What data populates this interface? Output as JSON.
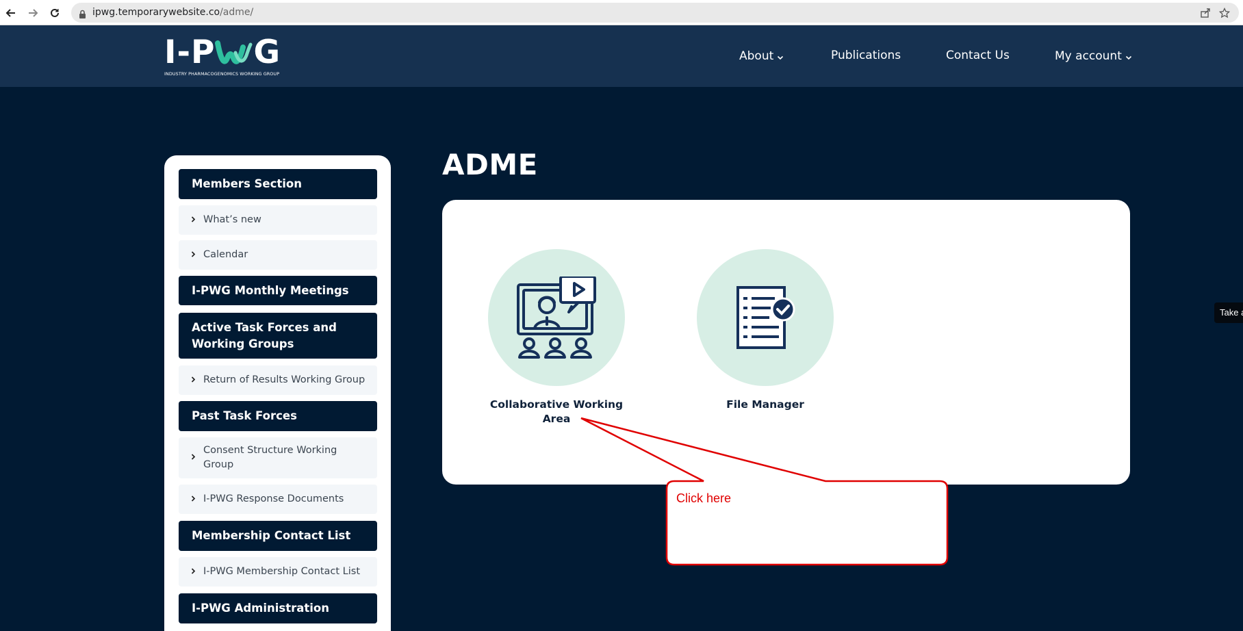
{
  "browser": {
    "url_host": "ipwg.temporarywebsite.co",
    "url_path": "/adme/"
  },
  "header": {
    "logo_text_left": "I-P",
    "logo_text_right": "G",
    "logo_subtitle": "INDUSTRY PHARMACOGENOMICS WORKING GROUP",
    "nav": {
      "about": "About",
      "publications": "Publications",
      "contact": "Contact Us",
      "account": "My account"
    }
  },
  "sidebar": {
    "members_section": "Members Section",
    "whats_new": "What’s new",
    "calendar": "Calendar",
    "monthly_meetings": "I-PWG Monthly Meetings",
    "active_task_forces": "Active Task Forces and Working Groups",
    "return_results": "Return of Results Working Group",
    "past_task_forces": "Past Task Forces",
    "consent_structure": "Consent Structure Working Group",
    "response_documents": "I-PWG Response Documents",
    "membership_contact": "Membership Contact List",
    "membership_contact_item": "I-PWG Membership Contact List",
    "administration": "I-PWG Administration"
  },
  "main": {
    "title": "ADME",
    "tiles": {
      "collab": "Collaborative Working Area",
      "files": "File Manager"
    }
  },
  "annotation": {
    "text": "Click here",
    "color": "#e00000"
  },
  "side_tab": {
    "label": "Take a"
  },
  "colors": {
    "page_bg": "#011a33",
    "header_bg": "#163150",
    "accent_teal": "#2fbf9e",
    "tile_circle": "#d7eee5",
    "icon_navy": "#15305a"
  }
}
